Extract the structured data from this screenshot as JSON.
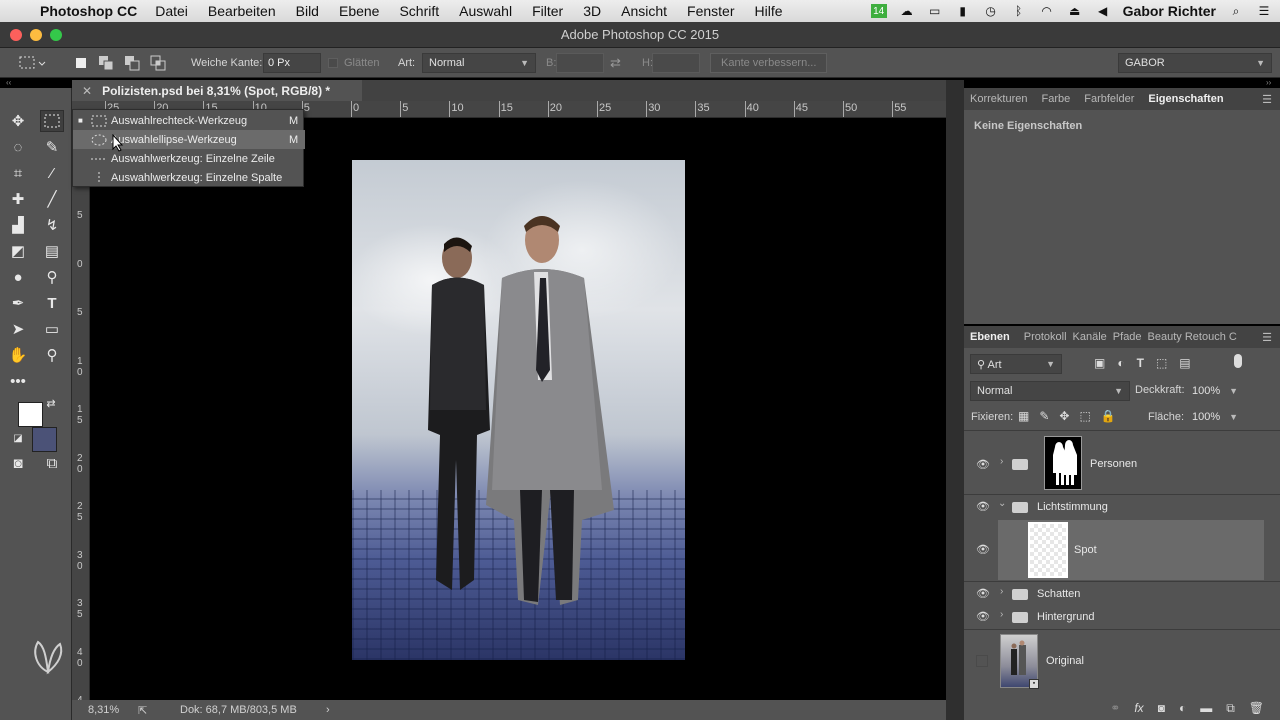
{
  "menubar": {
    "app_name": "Photoshop CC",
    "items": [
      "Datei",
      "Bearbeiten",
      "Bild",
      "Ebene",
      "Schrift",
      "Auswahl",
      "Filter",
      "3D",
      "Ansicht",
      "Fenster",
      "Hilfe"
    ],
    "user": "Gabor Richter"
  },
  "window": {
    "title": "Adobe Photoshop CC 2015"
  },
  "options": {
    "feather_label": "Weiche Kante:",
    "feather_value": "0 Px",
    "smooth_label": "Glätten",
    "style_label": "Art:",
    "style_value": "Normal",
    "width_label": "B:",
    "height_label": "H:",
    "refine_label": "Kante verbessern...",
    "workspace_value": "GABOR"
  },
  "document": {
    "tab_title": "Polizisten.psd bei 8,31% (Spot, RGB/8) *",
    "ruler_h_labels": [
      "25",
      "20",
      "15",
      "10",
      "5",
      "0",
      "5",
      "10",
      "15",
      "20",
      "25",
      "30",
      "35",
      "40",
      "45",
      "50",
      "55"
    ],
    "ruler_v_labels": [
      "5",
      "0",
      "5",
      "1 0",
      "1 5",
      "2 0",
      "2 5",
      "3 0",
      "3 5",
      "4 0",
      "4 5"
    ]
  },
  "flyout": {
    "items": [
      {
        "label": "Auswahlrechteck-Werkzeug",
        "key": "M"
      },
      {
        "label": "Auswahlellipse-Werkzeug",
        "key": "M"
      },
      {
        "label": "Auswahlwerkzeug: Einzelne Zeile",
        "key": ""
      },
      {
        "label": "Auswahlwerkzeug: Einzelne Spalte",
        "key": ""
      }
    ]
  },
  "status": {
    "zoom": "8,31%",
    "doc_info": "Dok: 68,7 MB/803,5 MB"
  },
  "properties_panel": {
    "tabs": [
      "Korrekturen",
      "Farbe",
      "Farbfelder",
      "Eigenschaften"
    ],
    "empty_text": "Keine Eigenschaften"
  },
  "layers_panel": {
    "tabs": [
      "Ebenen",
      "Protokoll",
      "Kanäle",
      "Pfade",
      "Beauty Retouch C"
    ],
    "filter_label": "Art",
    "blend_mode": "Normal",
    "opacity_label": "Deckkraft:",
    "opacity_value": "100%",
    "lock_label": "Fixieren:",
    "fill_label": "Fläche:",
    "fill_value": "100%",
    "layers": [
      {
        "name": "Personen",
        "type": "group-masked"
      },
      {
        "name": "Lichtstimmung",
        "type": "group-open"
      },
      {
        "name": "Spot",
        "type": "layer",
        "selected": true
      },
      {
        "name": "Schatten",
        "type": "group"
      },
      {
        "name": "Hintergrund",
        "type": "group"
      },
      {
        "name": "Original",
        "type": "layer-hidden"
      }
    ]
  },
  "colors": {
    "foreground": "#ffffff",
    "background": "#4b5277",
    "selected_layer": "#6a6a6a"
  }
}
